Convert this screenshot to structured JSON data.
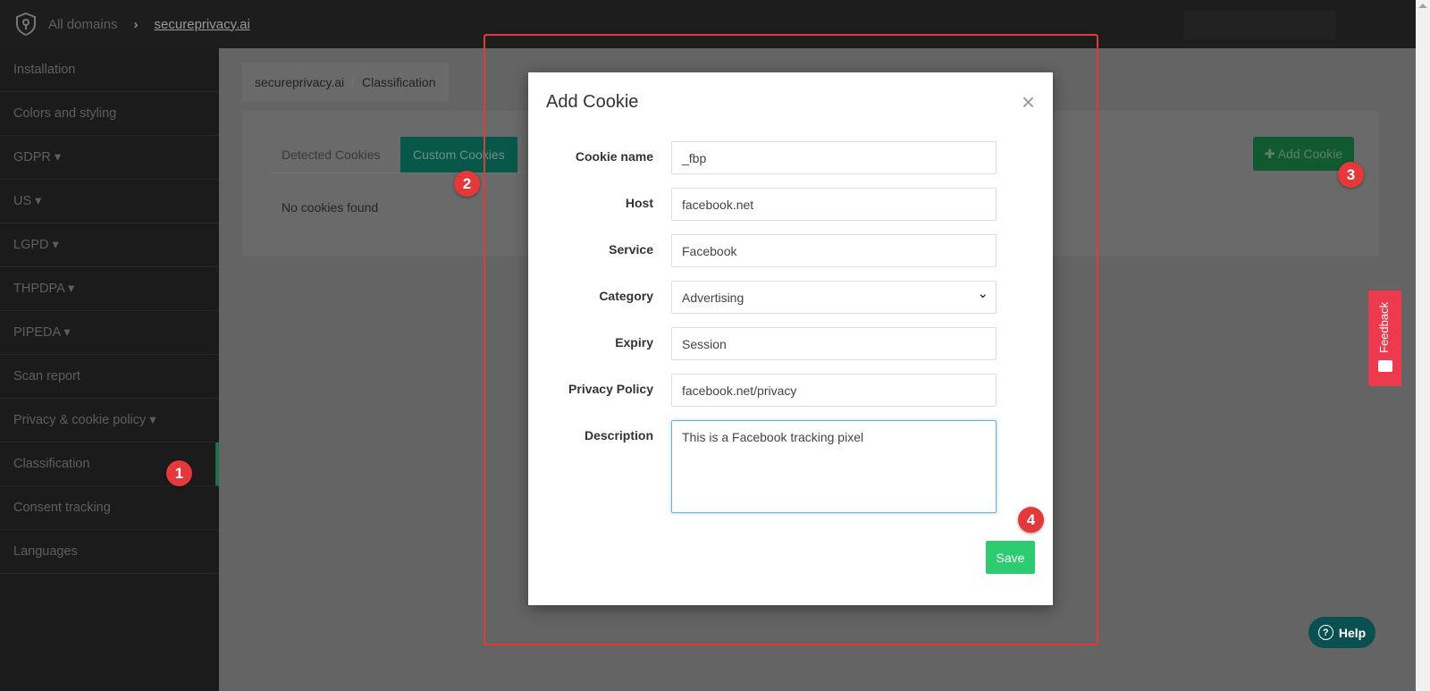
{
  "topbar": {
    "all_domains": "All domains",
    "site": "secureprivacy.ai"
  },
  "sidebar": {
    "items": [
      {
        "label": "Installation"
      },
      {
        "label": "Colors and styling"
      },
      {
        "label": "GDPR ▾"
      },
      {
        "label": "US ▾"
      },
      {
        "label": "LGPD ▾"
      },
      {
        "label": "THPDPA ▾"
      },
      {
        "label": "PIPEDA ▾"
      },
      {
        "label": "Scan report"
      },
      {
        "label": "Privacy & cookie policy ▾"
      },
      {
        "label": "Classification"
      },
      {
        "label": "Consent tracking"
      },
      {
        "label": "Languages"
      }
    ]
  },
  "breadcrumb": {
    "site": "secureprivacy.ai",
    "sep": "/",
    "page": "Classification"
  },
  "tabs": {
    "detected": "Detected Cookies",
    "custom": "Custom Cookies"
  },
  "empty": "No cookies found",
  "add_cookie": "✚ Add Cookie",
  "modal": {
    "title": "Add Cookie",
    "close": "×",
    "fields": [
      {
        "label": "Cookie name",
        "value": "_fbp"
      },
      {
        "label": "Host",
        "value": "facebook.net"
      },
      {
        "label": "Service",
        "value": "Facebook"
      },
      {
        "label": "Category",
        "value": "Advertising"
      },
      {
        "label": "Expiry",
        "value": "Session"
      },
      {
        "label": "Privacy Policy",
        "value": "facebook.net/privacy"
      },
      {
        "label": "Description",
        "value": "This is a Facebook tracking pixel"
      }
    ],
    "save": "Save"
  },
  "feedback": "Feedback",
  "help": "Help",
  "help_icon": "?",
  "badges": [
    "1",
    "2",
    "3",
    "4"
  ]
}
